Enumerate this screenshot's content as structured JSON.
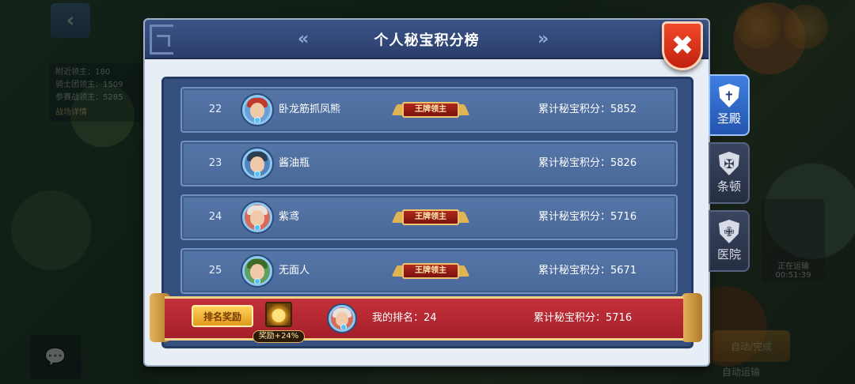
{
  "panel": {
    "title": "个人秘宝积分榜"
  },
  "background": {
    "info_lines": [
      "附近领主：180",
      "骑士团领主：1509",
      "参赛战领主：5285"
    ],
    "info_button": "战场详情",
    "right_card": "正在运输 00:51:39",
    "auto_button": "自动/完成",
    "auto_label": "自动运输"
  },
  "rows": [
    {
      "rank": "22",
      "name": "卧龙筋抓凤熊",
      "has_title": true,
      "score": "累计秘宝积分：5852",
      "hair": "#c0392b"
    },
    {
      "rank": "23",
      "name": "酱油瓶",
      "has_title": false,
      "score": "累计秘宝积分：5826",
      "hair": "#2c3e50"
    },
    {
      "rank": "24",
      "name": "紫鸢",
      "has_title": true,
      "score": "累计秘宝积分：5716",
      "hair": "#e8e2dc"
    },
    {
      "rank": "25",
      "name": "无面人",
      "has_title": true,
      "score": "累计秘宝积分：5671",
      "hair": "#3f6b2a"
    }
  ],
  "title_badge_label": "王牌领主",
  "my_bar": {
    "reward_button": "排名奖励",
    "bonus": "奖励+24%",
    "my_rank": "我的排名：24",
    "my_score": "累计秘宝积分：5716"
  },
  "tabs": [
    {
      "label": "圣殿",
      "glyph": "✝",
      "active": true
    },
    {
      "label": "条顿",
      "glyph": "✠",
      "active": false
    },
    {
      "label": "医院",
      "glyph": "✙",
      "active": false
    }
  ],
  "close_glyph": "✖",
  "nav": {
    "left": "«",
    "right": "»"
  },
  "colors": {
    "header": "#2a3e6a",
    "row": "#4a699a",
    "my_bar": "#a41f2a",
    "close": "#e0321c",
    "tab_active": "#2354b0"
  }
}
